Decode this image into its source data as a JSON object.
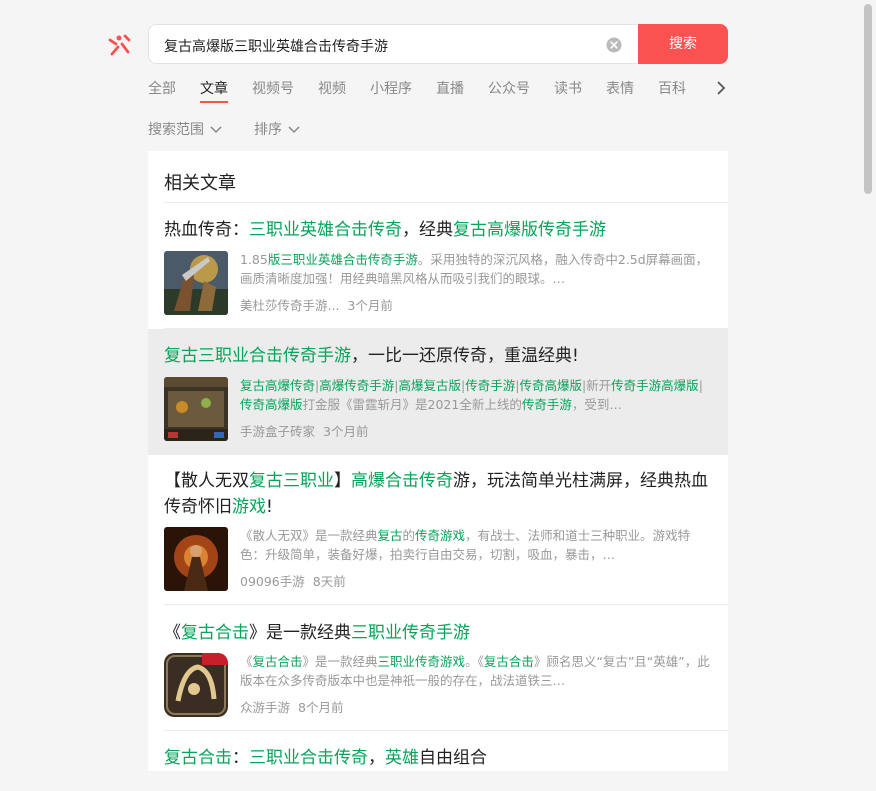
{
  "search": {
    "query": "复古高爆版三职业英雄合击传奇手游",
    "button_label": "搜索"
  },
  "tabs": [
    "全部",
    "文章",
    "视频号",
    "视频",
    "小程序",
    "直播",
    "公众号",
    "读书",
    "表情",
    "百科"
  ],
  "active_tab": "文章",
  "filters": {
    "range": "搜索范围",
    "sort": "排序"
  },
  "panel": {
    "title": "相关文章"
  },
  "articles": [
    {
      "title_parts": [
        {
          "t": "热血传奇：",
          "hl": false
        },
        {
          "t": "三职业英雄合击传奇",
          "hl": true
        },
        {
          "t": "，经典",
          "hl": false
        },
        {
          "t": "复古高爆版传奇手游",
          "hl": true
        }
      ],
      "desc_parts": [
        {
          "t": "1.85",
          "hl": false
        },
        {
          "t": "版三职业英雄合击传奇手游",
          "hl": true
        },
        {
          "t": "。采用独特的深沉风格，融入传奇中2.5d屏幕画面，画质清晰度加强！用经典暗黑风格从而吸引我们的眼球。…",
          "hl": false
        }
      ],
      "source": "美杜莎传奇手游...",
      "time": "3个月前",
      "thumb": "warrior-art"
    },
    {
      "title_parts": [
        {
          "t": "复古三职业合击传奇手游",
          "hl": true
        },
        {
          "t": "，一比一还原传奇，重温经典!",
          "hl": false
        }
      ],
      "desc_parts": [
        {
          "t": "复古高爆传奇",
          "hl": true
        },
        {
          "t": "|",
          "hl": false
        },
        {
          "t": "高爆传奇手游",
          "hl": true
        },
        {
          "t": "|",
          "hl": false
        },
        {
          "t": "高爆复古版",
          "hl": true
        },
        {
          "t": "|",
          "hl": false
        },
        {
          "t": "传奇手游",
          "hl": true
        },
        {
          "t": "|",
          "hl": false
        },
        {
          "t": "传奇高爆版",
          "hl": true
        },
        {
          "t": "|新开",
          "hl": false
        },
        {
          "t": "传奇手游高爆版",
          "hl": true
        },
        {
          "t": "|",
          "hl": false
        },
        {
          "t": "传奇高爆版",
          "hl": true
        },
        {
          "t": "打金服《雷霆斩月》是2021全新上线的",
          "hl": false
        },
        {
          "t": "传奇手游",
          "hl": true
        },
        {
          "t": "，受到…",
          "hl": false
        }
      ],
      "source": "手游盒子砖家",
      "time": "3个月前",
      "thumb": "game-ui"
    },
    {
      "title_parts": [
        {
          "t": "【散人无双",
          "hl": false
        },
        {
          "t": "复古三职业",
          "hl": true
        },
        {
          "t": "】",
          "hl": false
        },
        {
          "t": "高爆合击传奇",
          "hl": true
        },
        {
          "t": "游，玩法简单光柱满屏，经典热血传奇怀旧",
          "hl": false
        },
        {
          "t": "游戏",
          "hl": true
        },
        {
          "t": "!",
          "hl": false
        }
      ],
      "desc_parts": [
        {
          "t": "《散人无双》是一款经典",
          "hl": false
        },
        {
          "t": "复古",
          "hl": true
        },
        {
          "t": "的",
          "hl": false
        },
        {
          "t": "传奇游戏",
          "hl": true
        },
        {
          "t": "，有战士、法师和道士三种职业。游戏特色：升级简单，装备好爆，拍卖行自由交易，切割，吸血，暴击，…",
          "hl": false
        }
      ],
      "source": "09096手游",
      "time": "8天前",
      "thumb": "fire-warrior"
    },
    {
      "title_parts": [
        {
          "t": "《",
          "hl": false
        },
        {
          "t": "复古合击",
          "hl": true
        },
        {
          "t": "》是一款经典",
          "hl": false
        },
        {
          "t": "三职业传奇手游",
          "hl": true
        }
      ],
      "desc_parts": [
        {
          "t": "《",
          "hl": false
        },
        {
          "t": "复古合击",
          "hl": true
        },
        {
          "t": "》是一款经典",
          "hl": false
        },
        {
          "t": "三职业传奇游戏",
          "hl": true
        },
        {
          "t": "。《",
          "hl": false
        },
        {
          "t": "复古合击",
          "hl": true
        },
        {
          "t": "》顾名思义“复古”且“英雄”，此版本在众多传奇版本中也是神祇一般的存在，战法道铁三…",
          "hl": false
        }
      ],
      "source": "众游手游",
      "time": "8个月前",
      "thumb": "app-icon"
    },
    {
      "title_parts": [
        {
          "t": "复古合击",
          "hl": true
        },
        {
          "t": "：",
          "hl": false
        },
        {
          "t": "三职业合击传奇",
          "hl": true
        },
        {
          "t": "，",
          "hl": false
        },
        {
          "t": "英雄",
          "hl": true
        },
        {
          "t": "自由组合",
          "hl": false
        }
      ]
    }
  ],
  "colors": {
    "accent": "#fa5151",
    "highlight": "#07a35a",
    "muted": "#999999"
  }
}
